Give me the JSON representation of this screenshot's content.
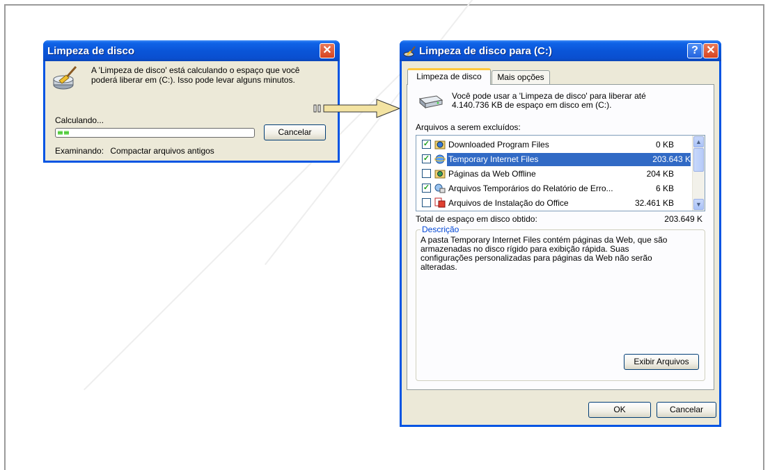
{
  "small_dialog": {
    "title": "Limpeza de disco",
    "message_line1": "A 'Limpeza de disco' está calculando o espaço que você",
    "message_line2": "poderá liberar em  (C:). Isso pode levar alguns minutos.",
    "status": "Calculando...",
    "progress_fraction": 0.06,
    "cancel_label": "Cancelar",
    "scanning_label": "Examinando:",
    "scanning_item": "Compactar arquivos antigos"
  },
  "main_dialog": {
    "title": "Limpeza de disco para  (C:)",
    "tabs": [
      {
        "label": "Limpeza de disco",
        "active": true
      },
      {
        "label": "Mais opções",
        "active": false
      }
    ],
    "intro_line1": "Você pode usar a 'Limpeza de disco' para liberar até",
    "intro_line2": "4.140.736 KB de espaço em disco em  (C:).",
    "files_label": "Arquivos a serem excluídos:",
    "files": [
      {
        "name": "Downloaded Program Files",
        "size": "0 KB",
        "checked": true,
        "selected": false,
        "icon": "globe-folder-icon"
      },
      {
        "name": "Temporary Internet Files",
        "size": "203.643 K",
        "checked": true,
        "selected": true,
        "icon": "internet-explorer-icon"
      },
      {
        "name": "Páginas da Web Offline",
        "size": "204 KB",
        "checked": false,
        "selected": false,
        "icon": "offline-pages-icon"
      },
      {
        "name": "Arquivos Temporários do Relatório de Erro...",
        "size": "6 KB",
        "checked": true,
        "selected": false,
        "icon": "error-report-icon"
      },
      {
        "name": "Arquivos de Instalação do Office",
        "size": "32.461 KB",
        "checked": false,
        "selected": false,
        "icon": "office-icon"
      }
    ],
    "total_label": "Total de espaço em disco obtido:",
    "total_value": "203.649 K",
    "description_legend": "Descrição",
    "description_lines": [
      "A pasta Temporary Internet Files contém páginas da Web, que são",
      "armazenadas no disco rígido para exibição rápida. Suas",
      "configurações personalizadas para páginas da Web não serão",
      "alteradas."
    ],
    "view_files_label": "Exibir Arquivos",
    "ok_label": "OK",
    "cancel_label": "Cancelar"
  },
  "colors": {
    "titlebar": "#0a55d8",
    "dialog_bg": "#ece9d8",
    "selection": "#316ac5",
    "progress": "#37c020",
    "arrow_fill": "#f3e3a2"
  }
}
